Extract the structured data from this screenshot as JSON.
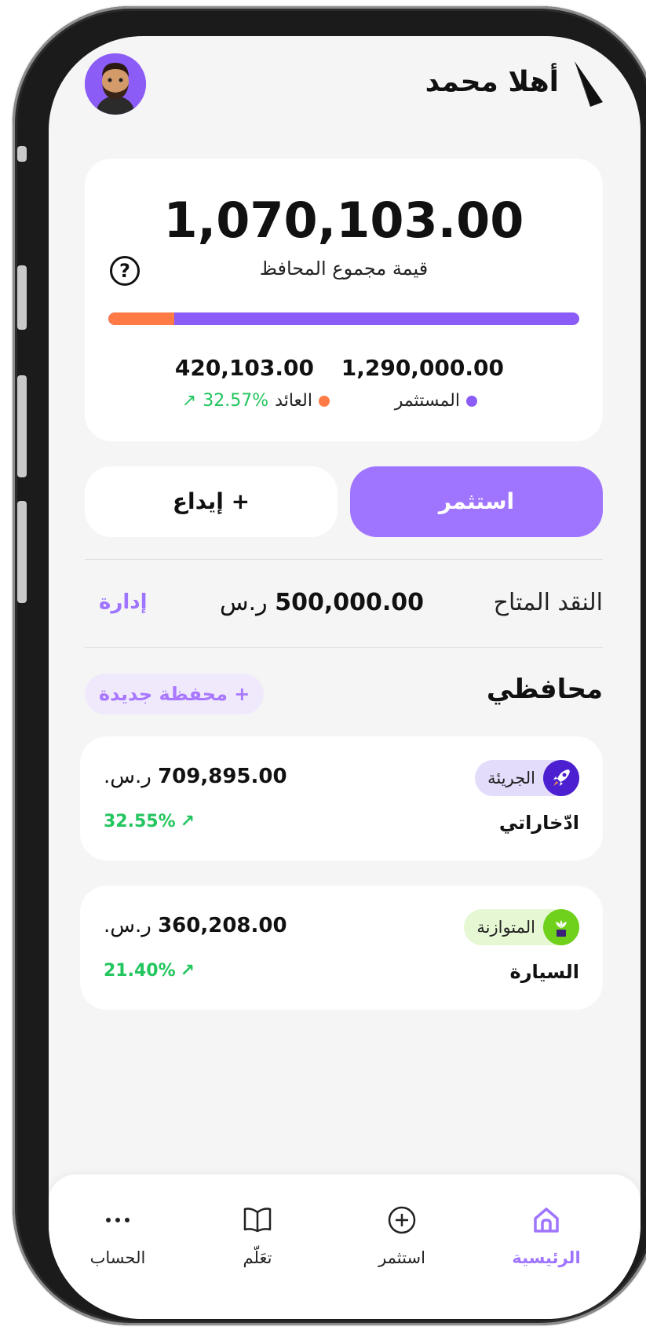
{
  "header": {
    "greeting": "أهلا محمد"
  },
  "summary": {
    "total_value": "1,070,103.00",
    "total_label": "قيمة مجموع المحافظ",
    "invested_value": "1,290,000.00",
    "invested_label": "المستثمر",
    "returns_value": "420,103.00",
    "returns_label": "العائد",
    "returns_pct": "32.57%",
    "returns_fraction": 0.14,
    "colors": {
      "invested": "#8b5cf6",
      "returns": "#ff7a45",
      "positive": "#22c55e"
    }
  },
  "actions": {
    "invest_label": "استثمر",
    "deposit_label": "+ إيداع"
  },
  "cash": {
    "label": "النقد المتاح",
    "amount": "500,000.00",
    "currency": "ر.س",
    "manage_label": "إدارة"
  },
  "portfolios": {
    "title": "محافظي",
    "new_label": "+ محفظة جديدة",
    "items": [
      {
        "badge": "الجريئة",
        "icon": "rocket-icon",
        "name": "ادّخاراتي",
        "amount": "709,895.00",
        "currency": "ر.س.",
        "return_pct": "32.55%"
      },
      {
        "badge": "المتوازنة",
        "icon": "plant-icon",
        "name": "السيارة",
        "amount": "360,208.00",
        "currency": "ر.س.",
        "return_pct": "21.40%"
      }
    ]
  },
  "nav": {
    "home": "الرئيسية",
    "invest": "استثمر",
    "learn": "تعَلّم",
    "account": "الحساب",
    "active": "home"
  },
  "accent_color": "#9f75ff"
}
